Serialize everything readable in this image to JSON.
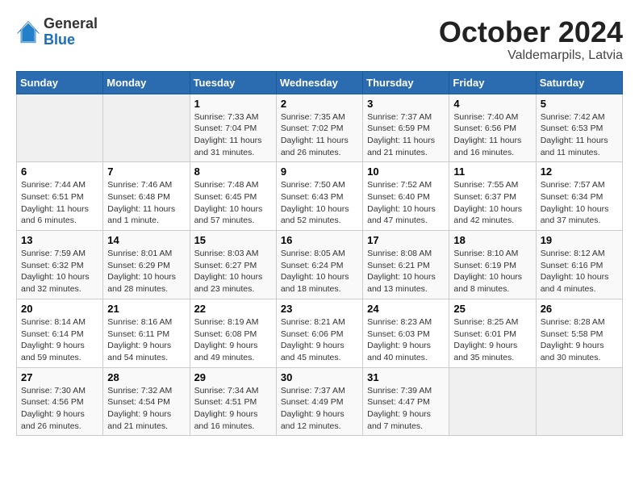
{
  "logo": {
    "general": "General",
    "blue": "Blue"
  },
  "title": {
    "month": "October 2024",
    "location": "Valdemarpils, Latvia"
  },
  "headers": [
    "Sunday",
    "Monday",
    "Tuesday",
    "Wednesday",
    "Thursday",
    "Friday",
    "Saturday"
  ],
  "weeks": [
    [
      {
        "day": "",
        "info": ""
      },
      {
        "day": "",
        "info": ""
      },
      {
        "day": "1",
        "info": "Sunrise: 7:33 AM\nSunset: 7:04 PM\nDaylight: 11 hours and 31 minutes."
      },
      {
        "day": "2",
        "info": "Sunrise: 7:35 AM\nSunset: 7:02 PM\nDaylight: 11 hours and 26 minutes."
      },
      {
        "day": "3",
        "info": "Sunrise: 7:37 AM\nSunset: 6:59 PM\nDaylight: 11 hours and 21 minutes."
      },
      {
        "day": "4",
        "info": "Sunrise: 7:40 AM\nSunset: 6:56 PM\nDaylight: 11 hours and 16 minutes."
      },
      {
        "day": "5",
        "info": "Sunrise: 7:42 AM\nSunset: 6:53 PM\nDaylight: 11 hours and 11 minutes."
      }
    ],
    [
      {
        "day": "6",
        "info": "Sunrise: 7:44 AM\nSunset: 6:51 PM\nDaylight: 11 hours and 6 minutes."
      },
      {
        "day": "7",
        "info": "Sunrise: 7:46 AM\nSunset: 6:48 PM\nDaylight: 11 hours and 1 minute."
      },
      {
        "day": "8",
        "info": "Sunrise: 7:48 AM\nSunset: 6:45 PM\nDaylight: 10 hours and 57 minutes."
      },
      {
        "day": "9",
        "info": "Sunrise: 7:50 AM\nSunset: 6:43 PM\nDaylight: 10 hours and 52 minutes."
      },
      {
        "day": "10",
        "info": "Sunrise: 7:52 AM\nSunset: 6:40 PM\nDaylight: 10 hours and 47 minutes."
      },
      {
        "day": "11",
        "info": "Sunrise: 7:55 AM\nSunset: 6:37 PM\nDaylight: 10 hours and 42 minutes."
      },
      {
        "day": "12",
        "info": "Sunrise: 7:57 AM\nSunset: 6:34 PM\nDaylight: 10 hours and 37 minutes."
      }
    ],
    [
      {
        "day": "13",
        "info": "Sunrise: 7:59 AM\nSunset: 6:32 PM\nDaylight: 10 hours and 32 minutes."
      },
      {
        "day": "14",
        "info": "Sunrise: 8:01 AM\nSunset: 6:29 PM\nDaylight: 10 hours and 28 minutes."
      },
      {
        "day": "15",
        "info": "Sunrise: 8:03 AM\nSunset: 6:27 PM\nDaylight: 10 hours and 23 minutes."
      },
      {
        "day": "16",
        "info": "Sunrise: 8:05 AM\nSunset: 6:24 PM\nDaylight: 10 hours and 18 minutes."
      },
      {
        "day": "17",
        "info": "Sunrise: 8:08 AM\nSunset: 6:21 PM\nDaylight: 10 hours and 13 minutes."
      },
      {
        "day": "18",
        "info": "Sunrise: 8:10 AM\nSunset: 6:19 PM\nDaylight: 10 hours and 8 minutes."
      },
      {
        "day": "19",
        "info": "Sunrise: 8:12 AM\nSunset: 6:16 PM\nDaylight: 10 hours and 4 minutes."
      }
    ],
    [
      {
        "day": "20",
        "info": "Sunrise: 8:14 AM\nSunset: 6:14 PM\nDaylight: 9 hours and 59 minutes."
      },
      {
        "day": "21",
        "info": "Sunrise: 8:16 AM\nSunset: 6:11 PM\nDaylight: 9 hours and 54 minutes."
      },
      {
        "day": "22",
        "info": "Sunrise: 8:19 AM\nSunset: 6:08 PM\nDaylight: 9 hours and 49 minutes."
      },
      {
        "day": "23",
        "info": "Sunrise: 8:21 AM\nSunset: 6:06 PM\nDaylight: 9 hours and 45 minutes."
      },
      {
        "day": "24",
        "info": "Sunrise: 8:23 AM\nSunset: 6:03 PM\nDaylight: 9 hours and 40 minutes."
      },
      {
        "day": "25",
        "info": "Sunrise: 8:25 AM\nSunset: 6:01 PM\nDaylight: 9 hours and 35 minutes."
      },
      {
        "day": "26",
        "info": "Sunrise: 8:28 AM\nSunset: 5:58 PM\nDaylight: 9 hours and 30 minutes."
      }
    ],
    [
      {
        "day": "27",
        "info": "Sunrise: 7:30 AM\nSunset: 4:56 PM\nDaylight: 9 hours and 26 minutes."
      },
      {
        "day": "28",
        "info": "Sunrise: 7:32 AM\nSunset: 4:54 PM\nDaylight: 9 hours and 21 minutes."
      },
      {
        "day": "29",
        "info": "Sunrise: 7:34 AM\nSunset: 4:51 PM\nDaylight: 9 hours and 16 minutes."
      },
      {
        "day": "30",
        "info": "Sunrise: 7:37 AM\nSunset: 4:49 PM\nDaylight: 9 hours and 12 minutes."
      },
      {
        "day": "31",
        "info": "Sunrise: 7:39 AM\nSunset: 4:47 PM\nDaylight: 9 hours and 7 minutes."
      },
      {
        "day": "",
        "info": ""
      },
      {
        "day": "",
        "info": ""
      }
    ]
  ]
}
